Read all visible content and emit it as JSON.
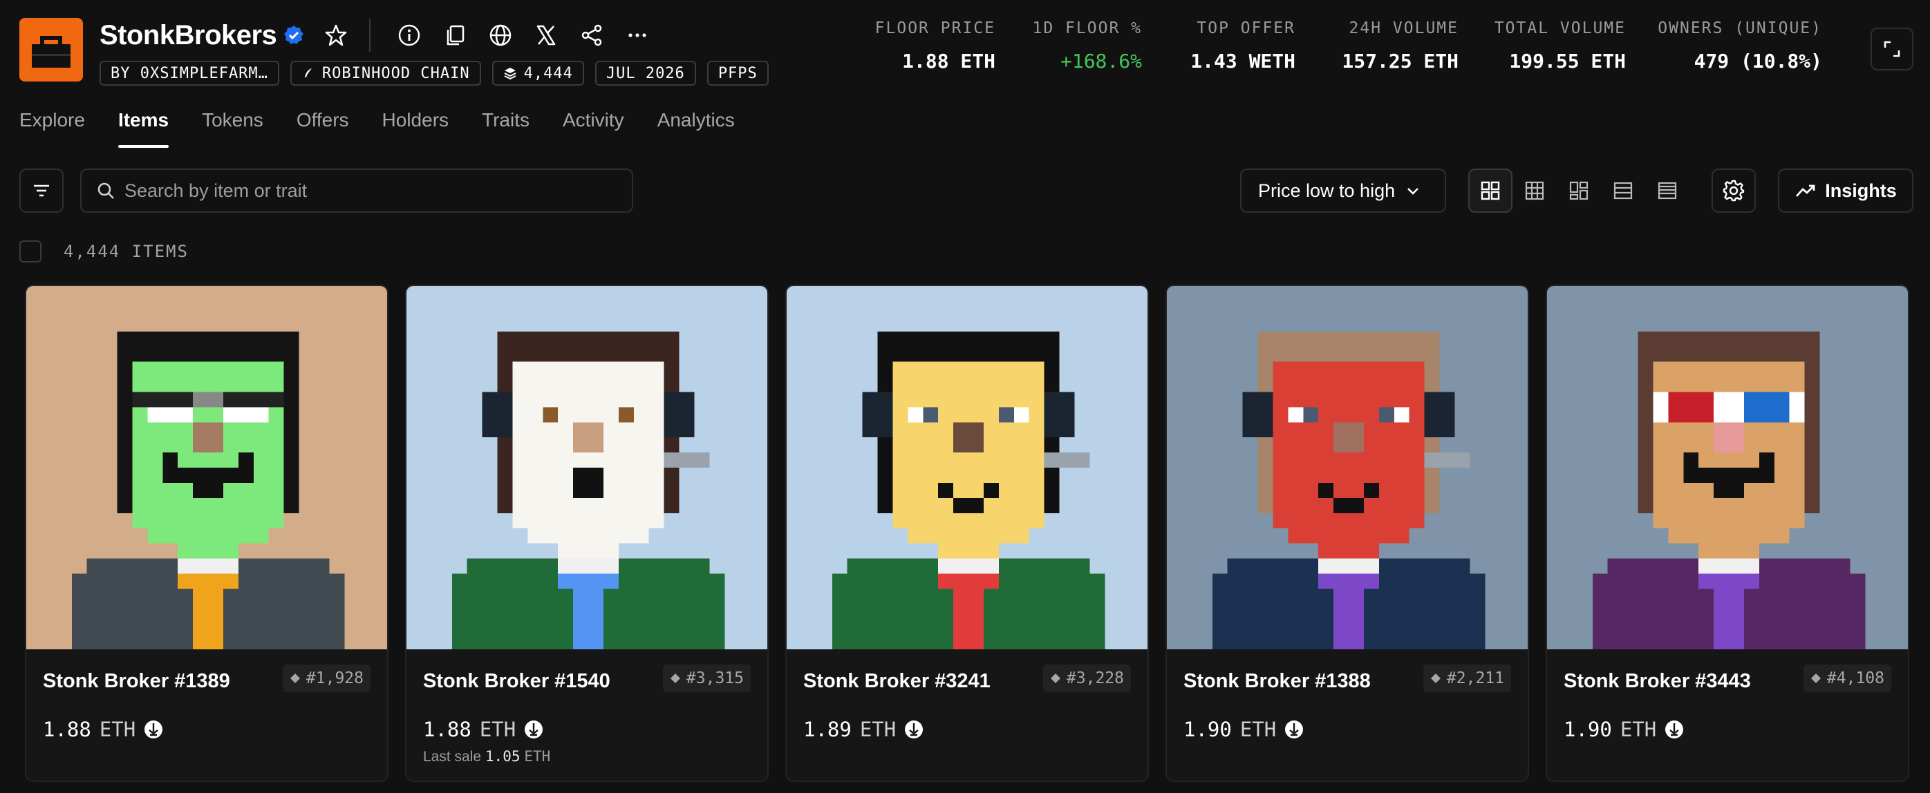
{
  "collection": {
    "title": "StonkBrokers",
    "brand_color": "#f0680f",
    "verified_color": "#1e6ff2",
    "chips": [
      {
        "label": "BY 0XSIMPLEFARM…",
        "icon": null
      },
      {
        "label": "ROBINHOOD CHAIN",
        "icon": "feather-icon"
      },
      {
        "label": "4,444",
        "icon": "layers-icon"
      },
      {
        "label": "JUL 2026",
        "icon": null
      },
      {
        "label": "PFPS",
        "icon": null
      }
    ]
  },
  "stats": [
    {
      "label": "FLOOR PRICE",
      "value": "1.88 ETH"
    },
    {
      "label": "1D FLOOR %",
      "value": "+168.6%"
    },
    {
      "label": "TOP OFFER",
      "value": "1.43 WETH"
    },
    {
      "label": "24H VOLUME",
      "value": "157.25 ETH"
    },
    {
      "label": "TOTAL VOLUME",
      "value": "199.55 ETH"
    },
    {
      "label": "OWNERS (UNIQUE)",
      "value": "479 (10.8%)"
    }
  ],
  "positive_color": "#43c65e",
  "tabs": [
    "Explore",
    "Items",
    "Tokens",
    "Offers",
    "Holders",
    "Traits",
    "Activity",
    "Analytics"
  ],
  "active_tab": "Items",
  "search": {
    "placeholder": "Search by item or trait"
  },
  "sort": {
    "label": "Price low to high"
  },
  "insights_label": "Insights",
  "items_count": "4,444 ITEMS",
  "items": [
    {
      "name": "Stonk Broker #1389",
      "rank": "#1,928",
      "price": "1.88",
      "unit": "ETH",
      "traits": {
        "bg": "#d3ac8a",
        "skin": "#7de87c",
        "skin_shade": "#b3b483",
        "hair": "#141414",
        "shirt": "#414a50",
        "tie": "#f0a41b",
        "eyes": "shades",
        "mouth": "frown",
        "nose": "#a57b64",
        "headset": false
      }
    },
    {
      "name": "Stonk Broker #1540",
      "rank": "#3,315",
      "price": "1.88",
      "unit": "ETH",
      "last_sale": {
        "label": "Last sale",
        "value": "1.05",
        "unit": "ETH"
      },
      "traits": {
        "bg": "#b9d2e8",
        "skin": "#f7f5f0",
        "hair": "#3a2520",
        "shirt": "#206c38",
        "tie": "#5494f2",
        "eyes": "small",
        "mouth": "open",
        "nose": "#c8a080",
        "headset": true
      }
    },
    {
      "name": "Stonk Broker #3241",
      "rank": "#3,228",
      "price": "1.89",
      "unit": "ETH",
      "traits": {
        "bg": "#b9d2e8",
        "skin": "#f7d46c",
        "hair": "#111111",
        "shirt": "#206c38",
        "tie": "#e23b3b",
        "eyes": "big",
        "mouth": "smile",
        "nose": "#6a4a3a",
        "headset": true
      }
    },
    {
      "name": "Stonk Broker #1388",
      "rank": "#2,211",
      "price": "1.90",
      "unit": "ETH",
      "traits": {
        "bg": "#7f94a8",
        "skin": "#da3f35",
        "hair": "#a8846a",
        "shirt": "#1a3152",
        "tie": "#7d48c7",
        "eyes": "big",
        "mouth": "smile",
        "nose": "#a07060",
        "headset": true
      }
    },
    {
      "name": "Stonk Broker #3443",
      "rank": "#4,108",
      "price": "1.90",
      "unit": "ETH",
      "traits": {
        "bg": "#7f94a8",
        "skin": "#dba268",
        "hair": "#5a3c33",
        "shirt": "#562863",
        "tie": "#7d48c7",
        "eyes": "3d",
        "mouth": "frown",
        "nose": "#e89a9a",
        "headset": false
      }
    }
  ]
}
